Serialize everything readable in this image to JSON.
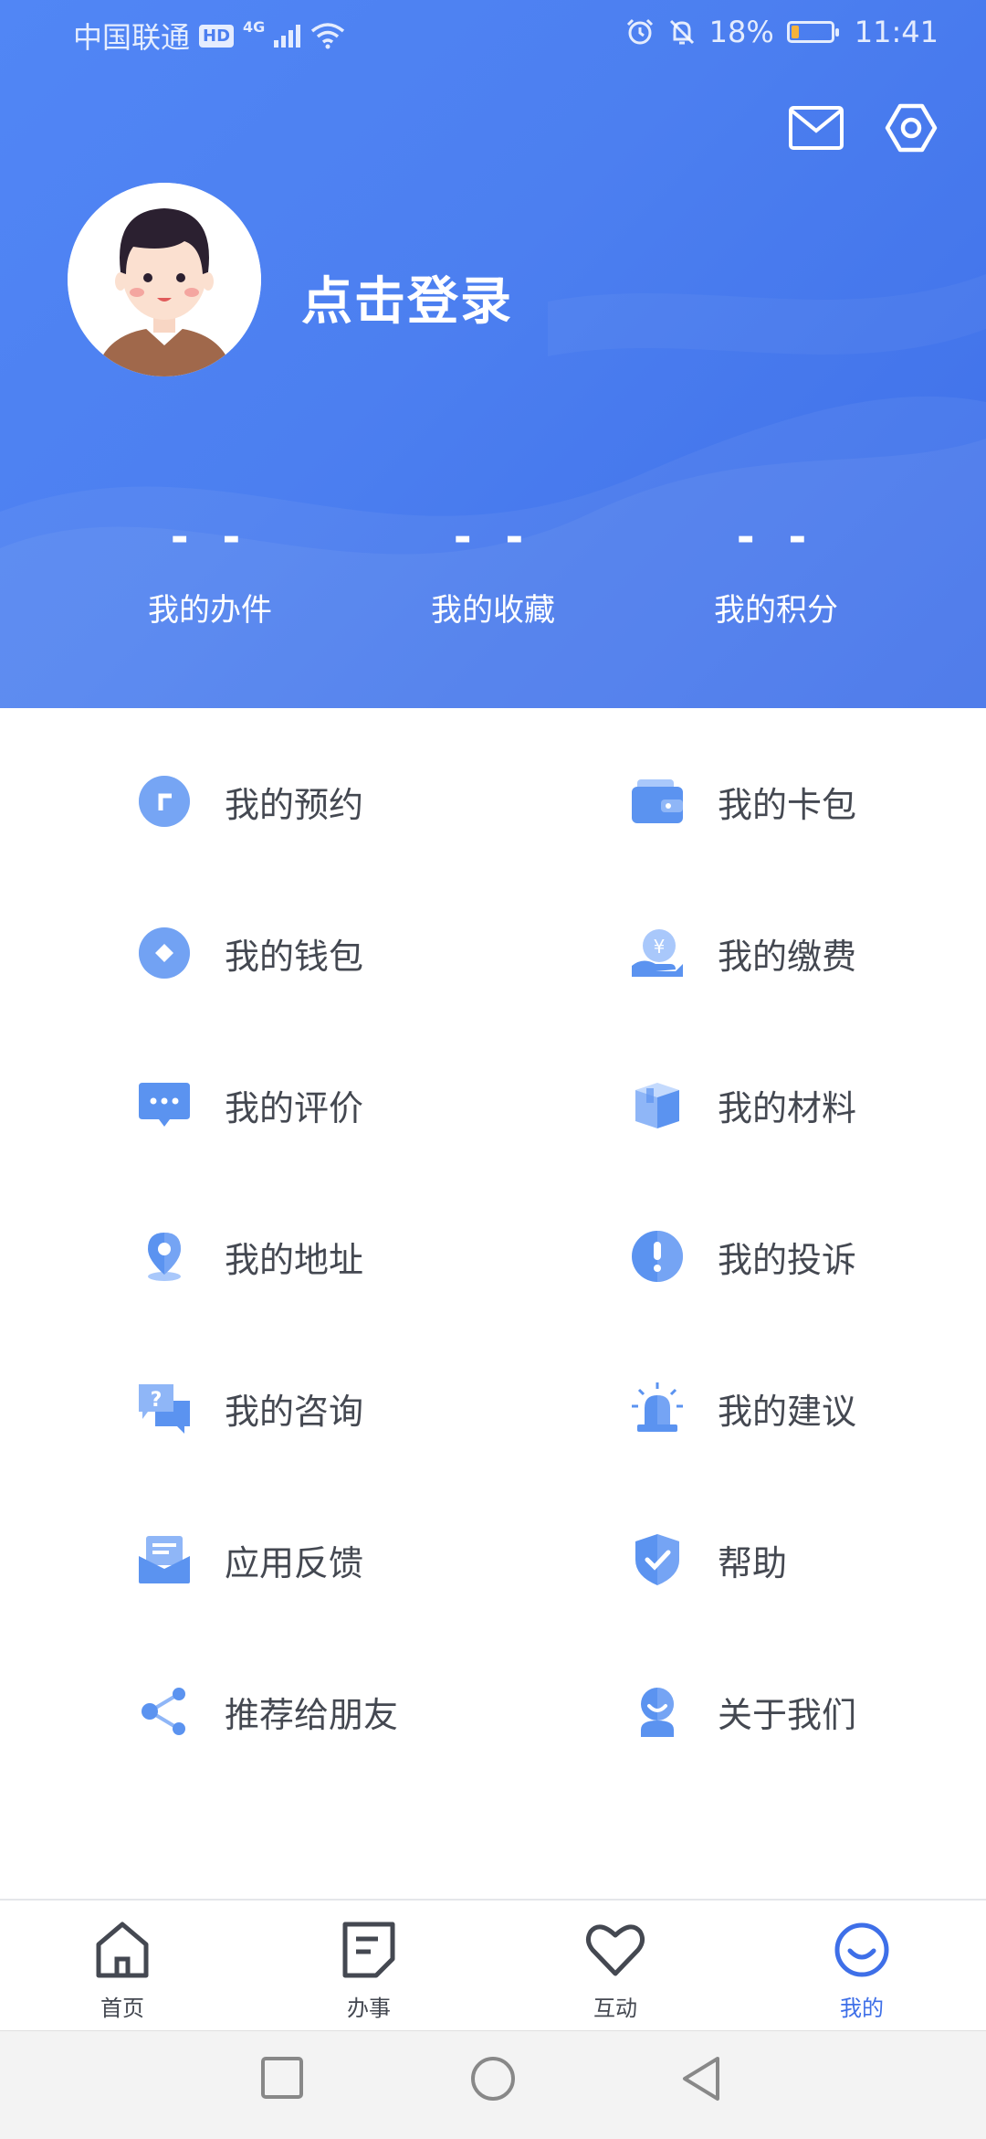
{
  "status_bar": {
    "carrier": "中国联通",
    "hd": "HD",
    "network": "4G",
    "battery_percent": "18%",
    "battery_level": 0.18,
    "time": "11:41"
  },
  "header": {
    "login_text": "点击登录",
    "stats": [
      {
        "value": "- -",
        "label": "我的办件"
      },
      {
        "value": "- -",
        "label": "我的收藏"
      },
      {
        "value": "- -",
        "label": "我的积分"
      }
    ]
  },
  "menu": {
    "items": [
      {
        "label": "我的预约",
        "icon": "appointment-icon"
      },
      {
        "label": "我的卡包",
        "icon": "card-wallet-icon"
      },
      {
        "label": "我的钱包",
        "icon": "wallet-icon"
      },
      {
        "label": "我的缴费",
        "icon": "payment-icon"
      },
      {
        "label": "我的评价",
        "icon": "comment-icon"
      },
      {
        "label": "我的材料",
        "icon": "materials-icon"
      },
      {
        "label": "我的地址",
        "icon": "location-icon"
      },
      {
        "label": "我的投诉",
        "icon": "complaint-icon"
      },
      {
        "label": "我的咨询",
        "icon": "consult-icon"
      },
      {
        "label": "我的建议",
        "icon": "suggestion-icon"
      },
      {
        "label": "应用反馈",
        "icon": "feedback-icon"
      },
      {
        "label": "帮助",
        "icon": "help-shield-icon"
      },
      {
        "label": "推荐给朋友",
        "icon": "share-icon"
      },
      {
        "label": "关于我们",
        "icon": "about-icon"
      }
    ]
  },
  "bottom_nav": {
    "tabs": [
      {
        "label": "首页",
        "icon": "home-icon"
      },
      {
        "label": "办事",
        "icon": "document-icon"
      },
      {
        "label": "互动",
        "icon": "heart-icon"
      },
      {
        "label": "我的",
        "icon": "smile-icon",
        "active": true
      }
    ]
  },
  "colors": {
    "brand_blue": "#4c7ff0",
    "icon_blue": "#5b93f0",
    "text_dark": "#444851"
  }
}
